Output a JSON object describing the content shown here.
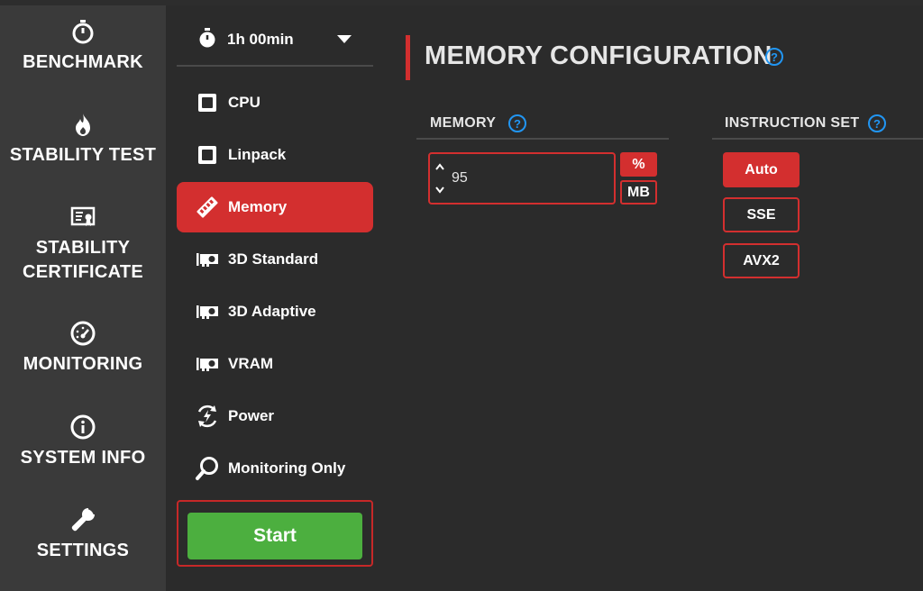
{
  "nav": {
    "items": [
      {
        "label": "BENCHMARK",
        "icon": "stopwatch-icon"
      },
      {
        "label": "STABILITY TEST",
        "icon": "flame-icon"
      },
      {
        "label": "STABILITY\nCERTIFICATE",
        "icon": "certificate-icon"
      },
      {
        "label": "MONITORING",
        "icon": "gauge-icon"
      },
      {
        "label": "SYSTEM INFO",
        "icon": "info-icon"
      },
      {
        "label": "SETTINGS",
        "icon": "wrench-icon"
      }
    ]
  },
  "tests": {
    "duration": "1h 00min",
    "items": [
      {
        "label": "CPU",
        "icon": "cpu-chip-icon"
      },
      {
        "label": "Linpack",
        "icon": "cpu-chip-icon"
      },
      {
        "label": "Memory",
        "icon": "memory-stick-icon",
        "active": true
      },
      {
        "label": "3D Standard",
        "icon": "gpu-card-icon"
      },
      {
        "label": "3D Adaptive",
        "icon": "gpu-card-icon"
      },
      {
        "label": "VRAM",
        "icon": "gpu-card-icon"
      },
      {
        "label": "Power",
        "icon": "power-cycle-icon"
      },
      {
        "label": "Monitoring Only",
        "icon": "magnifier-icon"
      }
    ],
    "start_label": "Start"
  },
  "main": {
    "title": "MEMORY CONFIGURATION",
    "memory": {
      "label": "MEMORY",
      "value": "95",
      "units": [
        "%",
        "MB"
      ],
      "selected_unit": "%"
    },
    "instruction_set": {
      "label": "INSTRUCTION SET",
      "options": [
        "Auto",
        "SSE",
        "AVX2"
      ],
      "selected": "Auto"
    },
    "help_glyph": "?"
  },
  "colors": {
    "accent": "#d32f2f",
    "start_green": "#4caf3f",
    "help_blue": "#2196f3",
    "nav_bg": "#3a3a3a",
    "panel_bg": "#2b2b2b"
  }
}
